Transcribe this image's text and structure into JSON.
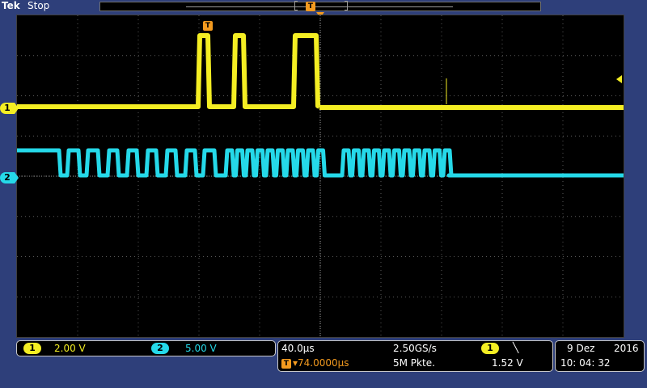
{
  "header": {
    "brand": "Tek",
    "status": "Stop",
    "trigger_marker": "T"
  },
  "channels": {
    "ch1": {
      "label": "1",
      "scale": "2.00 V",
      "color": "#f4ee23"
    },
    "ch2": {
      "label": "2",
      "scale": "5.00 V",
      "color": "#25d9e9"
    }
  },
  "waveform": {
    "trigger_marker": "T"
  },
  "timebase": {
    "horizontal_scale": "40.0µs",
    "sample_rate": "2.50GS/s",
    "trigger_position": "▾74.0000µs",
    "record_length": "5M Pkte.",
    "trigger_source": "1",
    "trigger_slope": "╲",
    "trigger_level": "1.52 V",
    "trigger_prefix_icon": "T→"
  },
  "clock": {
    "date_day_month": "9 Dez",
    "year": "2016",
    "time": "10: 04: 32"
  }
}
